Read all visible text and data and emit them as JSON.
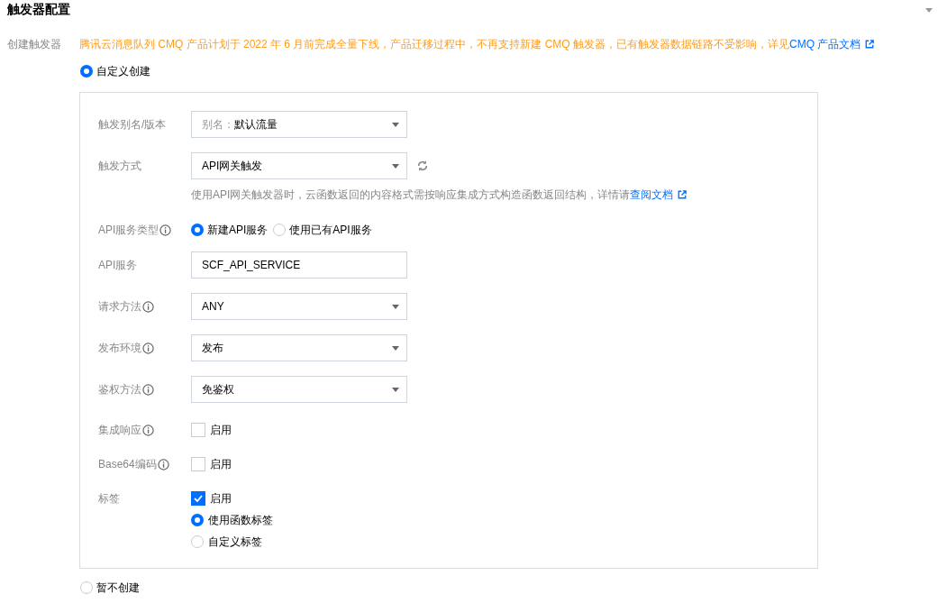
{
  "section": {
    "title": "触发器配置"
  },
  "notice": {
    "label": "创建触发器",
    "text": "腾讯云消息队列 CMQ 产品计划于 2022 年 6 月前完成全量下线，产品迁移过程中，不再支持新建 CMQ 触发器，已有触发器数据链路不受影响，详见",
    "link": "CMQ 产品文档"
  },
  "create_options": [
    {
      "label": "自定义创建",
      "selected": true
    },
    {
      "label": "暂不创建",
      "selected": false
    }
  ],
  "form": {
    "rows": [
      {
        "kind": "select",
        "label": "触发别名/版本",
        "info": false,
        "prefix": "别名：",
        "value": "默认流量"
      },
      {
        "kind": "select",
        "label": "触发方式",
        "info": false,
        "value": "API网关触发",
        "refresh": true,
        "help": "使用API网关触发器时，云函数返回的内容格式需按响应集成方式构造函数返回结构，详情请",
        "help_link": "查阅文档"
      },
      {
        "kind": "radio",
        "label": "API服务类型",
        "info": true,
        "options": [
          {
            "label": "新建API服务",
            "selected": true
          },
          {
            "label": "使用已有API服务",
            "selected": false
          }
        ]
      },
      {
        "kind": "input",
        "label": "API服务",
        "info": false,
        "value": "SCF_API_SERVICE"
      },
      {
        "kind": "select",
        "label": "请求方法",
        "info": true,
        "value": "ANY"
      },
      {
        "kind": "select",
        "label": "发布环境",
        "info": true,
        "value": "发布"
      },
      {
        "kind": "select",
        "label": "鉴权方法",
        "info": true,
        "value": "免鉴权"
      },
      {
        "kind": "checkbox",
        "label": "集成响应",
        "info": true,
        "checkbox": {
          "label": "启用",
          "checked": false
        }
      },
      {
        "kind": "checkbox",
        "label": "Base64编码",
        "info": true,
        "checkbox": {
          "label": "启用",
          "checked": false
        }
      },
      {
        "kind": "checkbox",
        "label": "标签",
        "info": false,
        "checkbox": {
          "label": "启用",
          "checked": true
        },
        "options": [
          {
            "label": "使用函数标签",
            "selected": true
          },
          {
            "label": "自定义标签",
            "selected": false
          }
        ]
      }
    ]
  }
}
